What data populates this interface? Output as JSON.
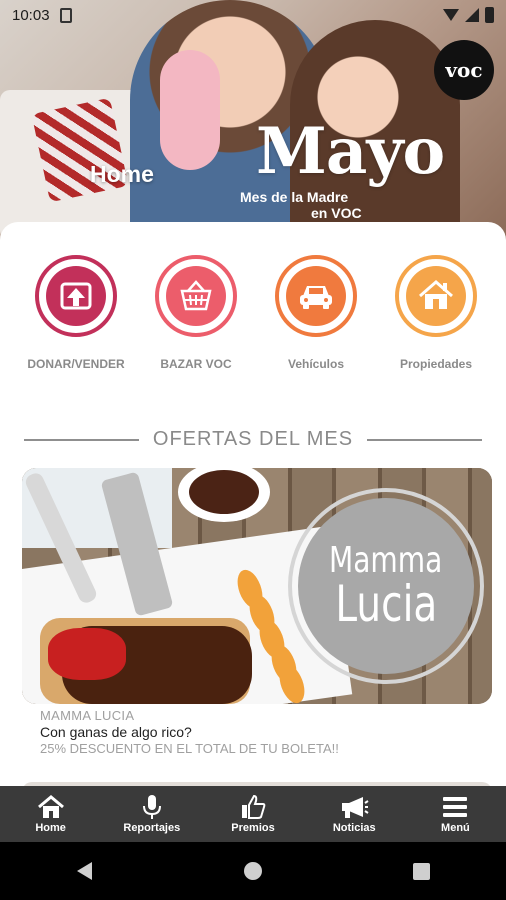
{
  "status_bar": {
    "time": "10:03",
    "icons": [
      "sim-card-icon",
      "wifi-icon",
      "signal-icon",
      "battery-icon"
    ]
  },
  "hero": {
    "home_label": "Home",
    "title": "Mayo",
    "subtitle_line1": "Mes de la Madre",
    "subtitle_line2": "en VOC",
    "logo_text": "voc"
  },
  "categories": [
    {
      "label": "DONAR/VENDER",
      "icon": "upload-icon",
      "color": "#c2305a"
    },
    {
      "label": "BAZAR VOC",
      "icon": "basket-icon",
      "color": "#ec5d6b"
    },
    {
      "label": "Vehículos",
      "icon": "car-icon",
      "color": "#f07a3e"
    },
    {
      "label": "Propiedades",
      "icon": "house-icon",
      "color": "#f5a54a"
    }
  ],
  "section": {
    "title": "OFERTAS DEL MES"
  },
  "offers": [
    {
      "badge_line1": "Mamma",
      "badge_line2": "Lucia",
      "brand": "MAMMA LUCIA",
      "title": "Con ganas de algo rico?",
      "description": "25% DESCUENTO EN EL TOTAL DE TU BOLETA!!"
    }
  ],
  "bottom_nav": [
    {
      "label": "Home",
      "icon": "home-icon"
    },
    {
      "label": "Reportajes",
      "icon": "microphone-icon"
    },
    {
      "label": "Premios",
      "icon": "thumbs-up-icon"
    },
    {
      "label": "Noticias",
      "icon": "megaphone-icon"
    },
    {
      "label": "Menú",
      "icon": "hamburger-menu-icon"
    }
  ],
  "system_nav": [
    "back-icon",
    "home-circle-icon",
    "recent-apps-icon"
  ]
}
